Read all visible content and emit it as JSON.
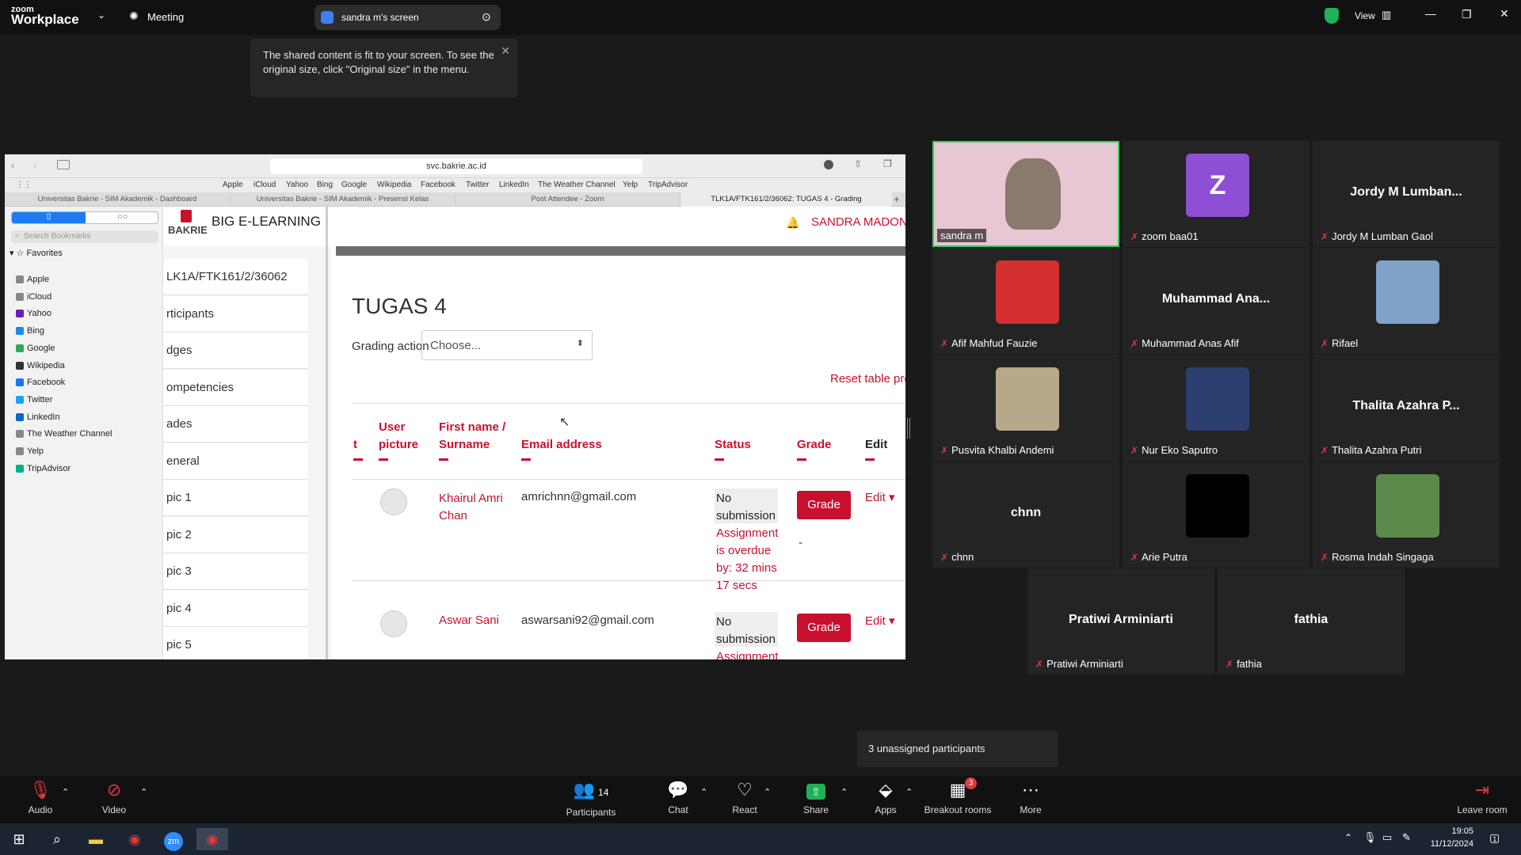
{
  "app": {
    "brand_top": "zoom",
    "brand_bottom": "Workplace",
    "meeting_label": "Meeting",
    "screen_pill": "sandra m's screen",
    "view_label": "View"
  },
  "tooltip": "The shared content is fit to your screen. To see the original size, click \"Original size\" in the menu.",
  "browser": {
    "url": "svc.bakrie.ac.id",
    "favbar": [
      "Apple",
      "iCloud",
      "Yahoo",
      "Bing",
      "Google",
      "Wikipedia",
      "Facebook",
      "Twitter",
      "LinkedIn",
      "The Weather Channel",
      "Yelp",
      "TripAdvisor"
    ],
    "tabs": [
      "Universitas Bakrie - SIM Akademik - Dashboard",
      "Universitas Bakrie - SIM Akademik - Presensi Kelas",
      "Post Attendee - Zoom",
      "TLK1A/FTK161/2/36062: TUGAS 4 - Grading"
    ],
    "sidebar": {
      "search_placeholder": "Search Bookmarks",
      "favorites_label": "Favorites",
      "items": [
        {
          "label": "Apple",
          "color": "#888888"
        },
        {
          "label": "iCloud",
          "color": "#888888"
        },
        {
          "label": "Yahoo",
          "color": "#6a1fb3"
        },
        {
          "label": "Bing",
          "color": "#1e88e5"
        },
        {
          "label": "Google",
          "color": "#34a853"
        },
        {
          "label": "Wikipedia",
          "color": "#333333"
        },
        {
          "label": "Facebook",
          "color": "#1877f2"
        },
        {
          "label": "Twitter",
          "color": "#1da1f2"
        },
        {
          "label": "LinkedIn",
          "color": "#0a66c2"
        },
        {
          "label": "The Weather Channel",
          "color": "#888888"
        },
        {
          "label": "Yelp",
          "color": "#888888"
        },
        {
          "label": "TripAdvisor",
          "color": "#00af87"
        }
      ]
    }
  },
  "moodle": {
    "logo_text": "BAKRIE",
    "site_title": "BIG E-LEARNING",
    "user_name": "SANDRA MADONN",
    "nav": [
      "LK1A/FTK161/2/36062",
      "rticipants",
      "dges",
      "ompetencies",
      "ades",
      "eneral",
      "pic 1",
      "pic 2",
      "pic 3",
      "pic 4",
      "pic 5"
    ],
    "page_title": "TUGAS 4",
    "grading_action_label": "Grading action",
    "choose_value": "Choose...",
    "reset_link": "Reset table pre",
    "headers": {
      "col0": "t",
      "user_picture": "User picture",
      "name": "First name / Surname",
      "email": "Email address",
      "status": "Status",
      "grade": "Grade",
      "edit": "Edit"
    },
    "rows": [
      {
        "name": "Khairul Amri Chan",
        "email": "amrichnn@gmail.com",
        "status": "No submission",
        "overdue": "Assignment is overdue by: 32 mins 17 secs",
        "grade_btn": "Grade",
        "grade_value": "-",
        "edit": "Edit"
      },
      {
        "name": "Aswar Sani",
        "email": "aswarsani92@gmail.com",
        "status": "No submission",
        "overdue": "Assignment",
        "grade_btn": "Grade",
        "edit": "Edit"
      }
    ]
  },
  "gallery": [
    {
      "name": "sandra m",
      "type": "video",
      "active": true
    },
    {
      "name": "zoom baa01",
      "type": "letter",
      "letter": "Z"
    },
    {
      "name": "Jordy M Lumban Gaol",
      "type": "text",
      "display": "Jordy M Lumban..."
    },
    {
      "name": "Afif Mahfud Fauzie",
      "type": "photo",
      "color": "#d32f2f"
    },
    {
      "name": "Muhammad Anas Afif",
      "type": "text",
      "display": "Muhammad  Ana..."
    },
    {
      "name": "Rifael",
      "type": "photo",
      "color": "#7fa3c8"
    },
    {
      "name": "Pusvita Khalbi Andemi",
      "type": "photo",
      "color": "#b8a88a"
    },
    {
      "name": "Nur Eko Saputro",
      "type": "photo",
      "color": "#2c3e70"
    },
    {
      "name": "Thalita Azahra Putri",
      "type": "text",
      "display": "Thalita Azahra P..."
    },
    {
      "name": "chnn",
      "type": "text",
      "display": "chnn"
    },
    {
      "name": "Arie Putra",
      "type": "photo",
      "color": "#000000"
    },
    {
      "name": "Rosma Indah Singaga",
      "type": "photo",
      "color": "#5c8a4a"
    },
    {
      "name": "Pratiwi Arminiarti",
      "type": "text",
      "display": "Pratiwi Arminiarti"
    },
    {
      "name": "fathia",
      "type": "text",
      "display": "fathia"
    }
  ],
  "unassigned": "3 unassigned participants",
  "toolbar": {
    "audio": "Audio",
    "video": "Video",
    "participants": "Participants",
    "participants_count": "14",
    "chat": "Chat",
    "react": "React",
    "share": "Share",
    "apps": "Apps",
    "breakout": "Breakout rooms",
    "breakout_badge": "3",
    "more": "More",
    "leave": "Leave room"
  },
  "taskbar": {
    "time": "19:05",
    "date": "11/12/2024",
    "notif": "1"
  }
}
